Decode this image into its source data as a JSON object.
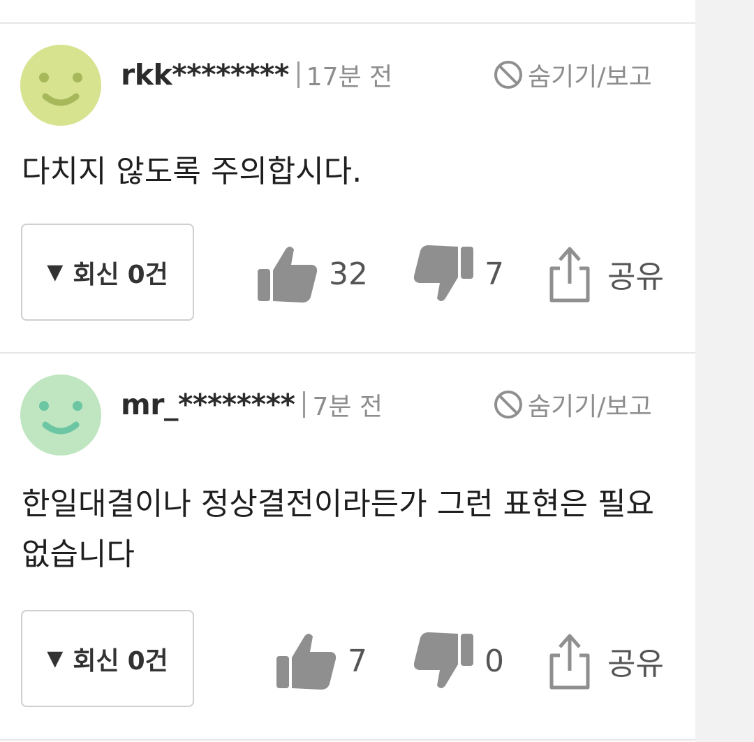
{
  "comments": [
    {
      "username": "rkk********",
      "time": "17분 전",
      "hide_report": "숨기기/보고",
      "text": "다치지 않도록 주의합시다.",
      "reply_label": "회신",
      "reply_count": "0건",
      "likes": "32",
      "dislikes": "7",
      "share": "공유",
      "avatar_color": "#d7e38f",
      "avatar_face_color": "#a7b85a"
    },
    {
      "username": "mr_********",
      "time": "7분 전",
      "hide_report": "숨기기/보고",
      "text": "한일대결이나 정상결전이라든가 그런 표현은 필요 없습니다",
      "reply_label": "회신",
      "reply_count": "0건",
      "likes": "7",
      "dislikes": "0",
      "share": "공유",
      "avatar_color": "#bfe6c0",
      "avatar_face_color": "#6cc6a4"
    }
  ],
  "icons": {
    "hide": "no-entry-icon",
    "reply_toggle": "triangle-down-icon",
    "like": "thumbs-up-icon",
    "dislike": "thumbs-down-icon",
    "share": "share-icon",
    "avatar": "smiley-face-icon"
  },
  "colors": {
    "icon_gray": "#8f8f8f",
    "meta_gray": "#8d8d8d",
    "divider": "#e6e6e6"
  }
}
